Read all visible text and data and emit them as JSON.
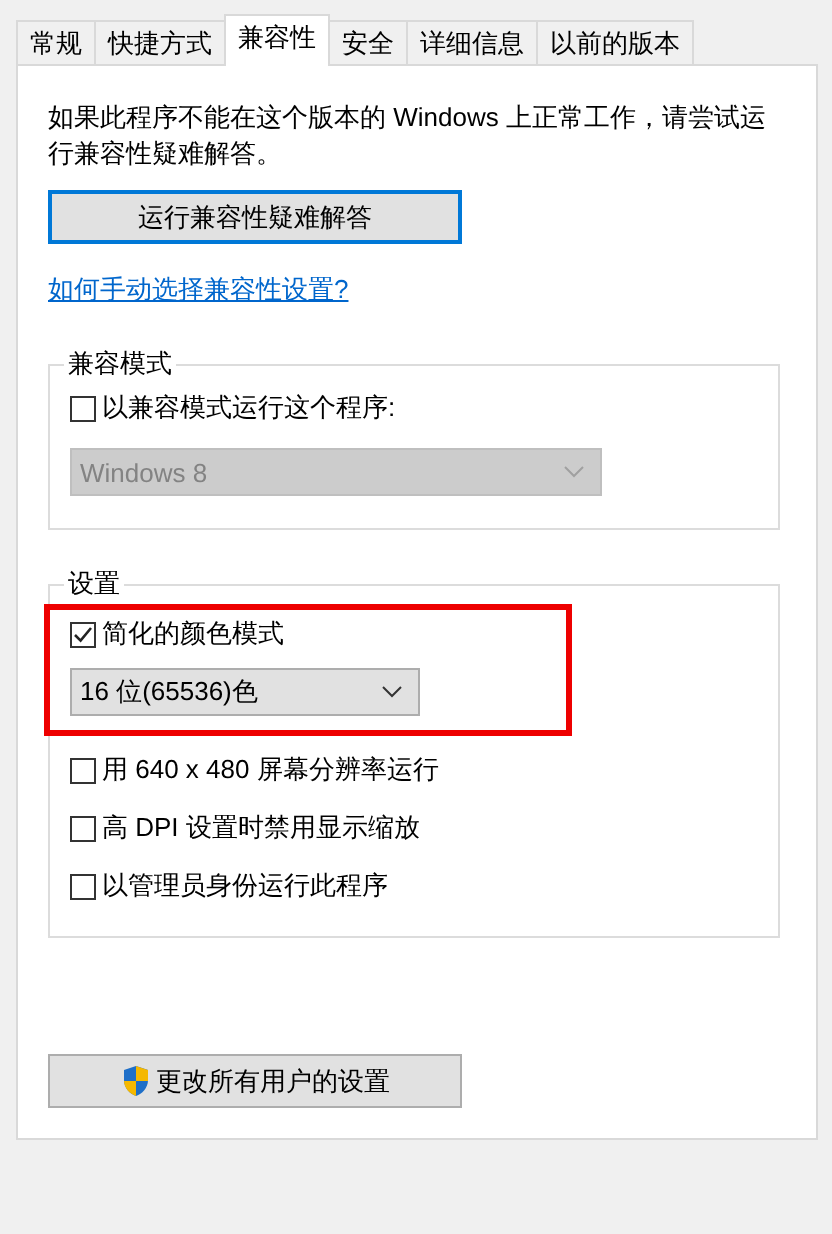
{
  "tabs": [
    {
      "label": "常规",
      "selected": false
    },
    {
      "label": "快捷方式",
      "selected": false
    },
    {
      "label": "兼容性",
      "selected": true
    },
    {
      "label": "安全",
      "selected": false
    },
    {
      "label": "详细信息",
      "selected": false
    },
    {
      "label": "以前的版本",
      "selected": false
    }
  ],
  "intro": "如果此程序不能在这个版本的 Windows 上正常工作，请尝试运行兼容性疑难解答。",
  "troubleshoot_button": {
    "label": "运行兼容性疑难解答",
    "focused": true
  },
  "help_link": "如何手动选择兼容性设置?",
  "compat_mode": {
    "title": "兼容模式",
    "items": [
      {
        "kind": "checkbox",
        "label": "以兼容模式运行这个程序:",
        "checked": false,
        "highlighted": false
      },
      {
        "kind": "dropdown",
        "value": "Windows 8",
        "disabled": true,
        "highlighted": false
      }
    ]
  },
  "settings": {
    "title": "设置",
    "items": [
      {
        "kind": "checkbox",
        "label": "简化的颜色模式",
        "checked": true,
        "highlighted": true
      },
      {
        "kind": "dropdown",
        "value": "16 位(65536)色",
        "disabled": false,
        "highlighted": true
      },
      {
        "kind": "checkbox",
        "label": "用 640 x 480 屏幕分辨率运行",
        "checked": false,
        "highlighted": false
      },
      {
        "kind": "checkbox",
        "label": "高 DPI 设置时禁用显示缩放",
        "checked": false,
        "highlighted": false
      },
      {
        "kind": "checkbox",
        "label": "以管理员身份运行此程序",
        "checked": false,
        "highlighted": false
      }
    ]
  },
  "all_users_button": {
    "label": "更改所有用户的设置",
    "focused": false
  }
}
